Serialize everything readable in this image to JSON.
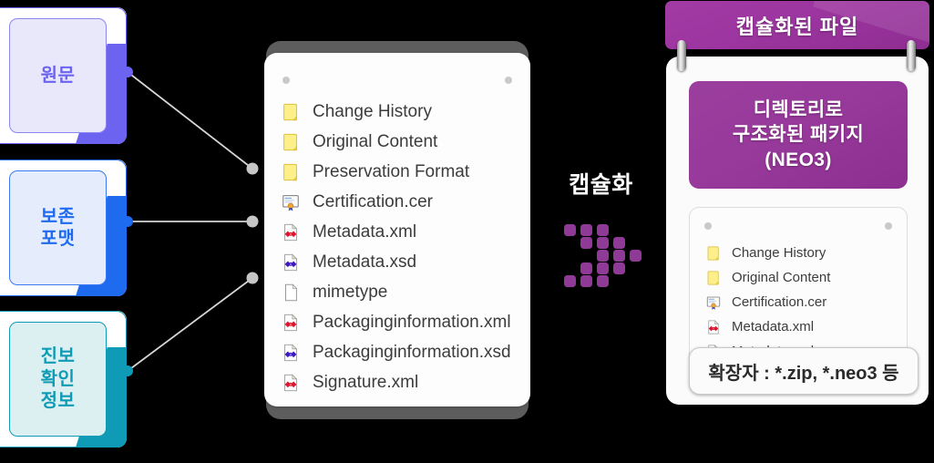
{
  "sources": [
    {
      "id": "wonmun",
      "label": "원문",
      "accent": "#6c63f0",
      "fill": "#e9e8fb",
      "border": "#8b85f2",
      "dot": "#6c63f0"
    },
    {
      "id": "bojon",
      "label": "보존\n포맷",
      "accent": "#1f6bf0",
      "fill": "#e5edfd",
      "border": "#3a7af5",
      "dot": "#1f6bf0"
    },
    {
      "id": "jinbo",
      "label": "진보\n확인\n정보",
      "accent": "#0f9bb5",
      "fill": "#dcf0f2",
      "border": "#0f9bb5",
      "dot": "#0f9bb5"
    }
  ],
  "package": {
    "files": [
      {
        "name": "Change History",
        "icon": "folder-icon"
      },
      {
        "name": "Original Content",
        "icon": "folder-icon"
      },
      {
        "name": "Preservation Format",
        "icon": "folder-icon"
      },
      {
        "name": "Certification.cer",
        "icon": "certificate-icon"
      },
      {
        "name": "Metadata.xml",
        "icon": "xml-file-icon"
      },
      {
        "name": "Metadata.xsd",
        "icon": "xsd-file-icon"
      },
      {
        "name": "mimetype",
        "icon": "blank-file-icon"
      },
      {
        "name": "Packaginginformation.xml",
        "icon": "xml-file-icon"
      },
      {
        "name": "Packaginginformation.xsd",
        "icon": "xsd-file-icon"
      },
      {
        "name": "Signature.xml",
        "icon": "xml-file-icon"
      }
    ]
  },
  "process": {
    "label": "캡슐화",
    "arrow_icon": "dotted-arrow-right-icon",
    "arrow_color": "#8e3a96"
  },
  "capsule": {
    "banner_title": "캡슐화된 파일",
    "package_title": "디렉토리로\n구조화된 패키지\n(NEO3)",
    "files": [
      {
        "name": "Change History",
        "icon": "folder-icon"
      },
      {
        "name": "Original Content",
        "icon": "folder-icon"
      },
      {
        "name": "Certification.cer",
        "icon": "certificate-icon"
      },
      {
        "name": "Metadata.xml",
        "icon": "xml-file-icon"
      },
      {
        "name": "Metadata.xsd",
        "icon": "xsd-file-icon"
      }
    ],
    "extension_label": "확장자 : *.zip, *.neo3 등"
  },
  "colors": {
    "background": "#000000",
    "purple": "#9c359f",
    "panel_bar": "#5d5d5d",
    "connector_line": "#d6d6d6",
    "connector_end_dot": "#c6c6c6"
  }
}
